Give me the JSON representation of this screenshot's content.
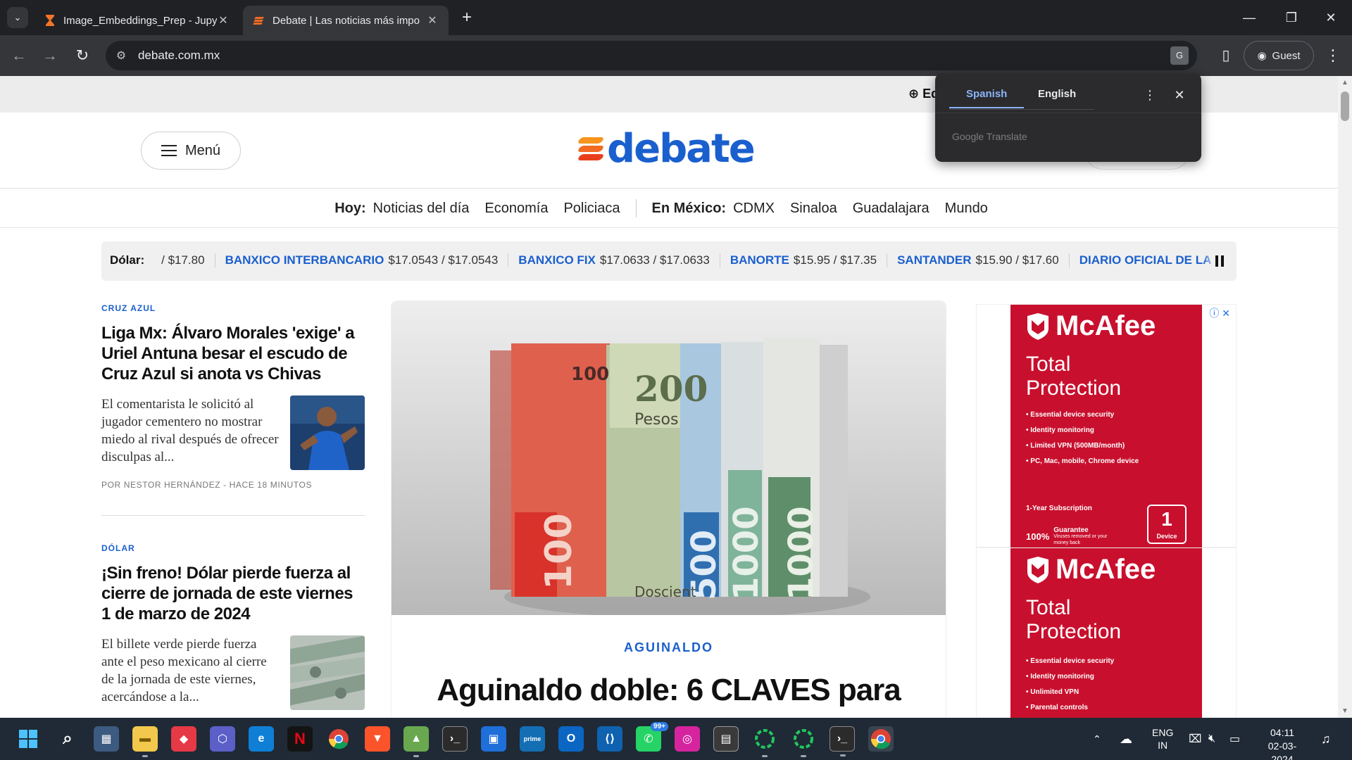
{
  "browser": {
    "tabs": [
      {
        "title": "Image_Embeddings_Prep - Jupy",
        "active": false
      },
      {
        "title": "Debate | Las noticias más impo",
        "active": true
      }
    ],
    "url": "debate.com.mx",
    "profile_label": "Guest"
  },
  "translate_popup": {
    "tabs": [
      "Spanish",
      "English"
    ],
    "active_tab": "Spanish",
    "footer": "Google Translate"
  },
  "site": {
    "edition_label": "Ed",
    "menu_label": "Menú",
    "logo_text": "debate",
    "nav": {
      "today_label": "Hoy:",
      "today_links": [
        "Noticias del día",
        "Economía",
        "Policiaca"
      ],
      "mexico_label": "En México:",
      "mexico_links": [
        "CDMX",
        "Sinaloa",
        "Guadalajara",
        "Mundo"
      ]
    },
    "ticker": {
      "label": "Dólar:",
      "lead_value": "/ $17.80",
      "items": [
        {
          "name": "BANXICO INTERBANCARIO",
          "value": "$17.0543 / $17.0543"
        },
        {
          "name": "BANXICO FIX",
          "value": "$17.0633 / $17.0633"
        },
        {
          "name": "BANORTE",
          "value": "$15.95 / $17.35"
        },
        {
          "name": "SANTANDER",
          "value": "$15.90 / $17.60"
        },
        {
          "name": "DIARIO OFICIAL DE LA",
          "value": ""
        }
      ]
    },
    "articles": [
      {
        "kicker": "CRUZ AZUL",
        "headline": "Liga Mx: Álvaro Morales 'exige' a Uriel Antuna besar el escudo de Cruz Azul si anota vs Chivas",
        "summary": "El comentarista le solicitó al jugador cementero no mostrar miedo al rival después de ofrecer disculpas al...",
        "byline": "POR NESTOR HERNÁNDEZ - HACE 18 MINUTOS"
      },
      {
        "kicker": "DÓLAR",
        "headline": "¡Sin freno! Dólar pierde fuerza al cierre de jornada de este viernes 1 de marzo de 2024",
        "summary": "El billete verde pierde fuerza ante el peso mexicano al cierre de la jornada de este viernes, acercándose a la..."
      }
    ],
    "hero": {
      "kicker": "AGUINALDO",
      "title": "Aguinaldo doble: 6 CLAVES para",
      "image_notes": [
        "100",
        "200",
        "Pesos",
        "500",
        "1000",
        "1000",
        "Doscient"
      ]
    },
    "ads": [
      {
        "brand": "McAfee",
        "title_line1": "Total",
        "title_line2": "Protection",
        "features": [
          "• Essential device security",
          "• Identity monitoring",
          "• Limited VPN (500MB/month)",
          "• PC, Mac, mobile, Chrome device"
        ],
        "subscription": "1-Year Subscription",
        "guarantee": "Guarantee",
        "guarantee_small": "Viruses removed or your money back",
        "guarantee_pct": "100%",
        "device_count": "1",
        "device_label": "Device"
      },
      {
        "brand": "McAfee",
        "title_line1": "Total",
        "title_line2": "Protection",
        "features": [
          "• Essential device security",
          "• Identity monitoring",
          "• Unlimited VPN",
          "• Parental controls"
        ]
      }
    ]
  },
  "taskbar": {
    "language": "ENG",
    "region": "IN",
    "time": "04:11",
    "date": "02-03-2024",
    "whatsapp_badge": "99+"
  },
  "colors": {
    "brand_blue": "#1a5fce",
    "ad_red": "#c8102e",
    "chrome_dark": "#202124"
  }
}
